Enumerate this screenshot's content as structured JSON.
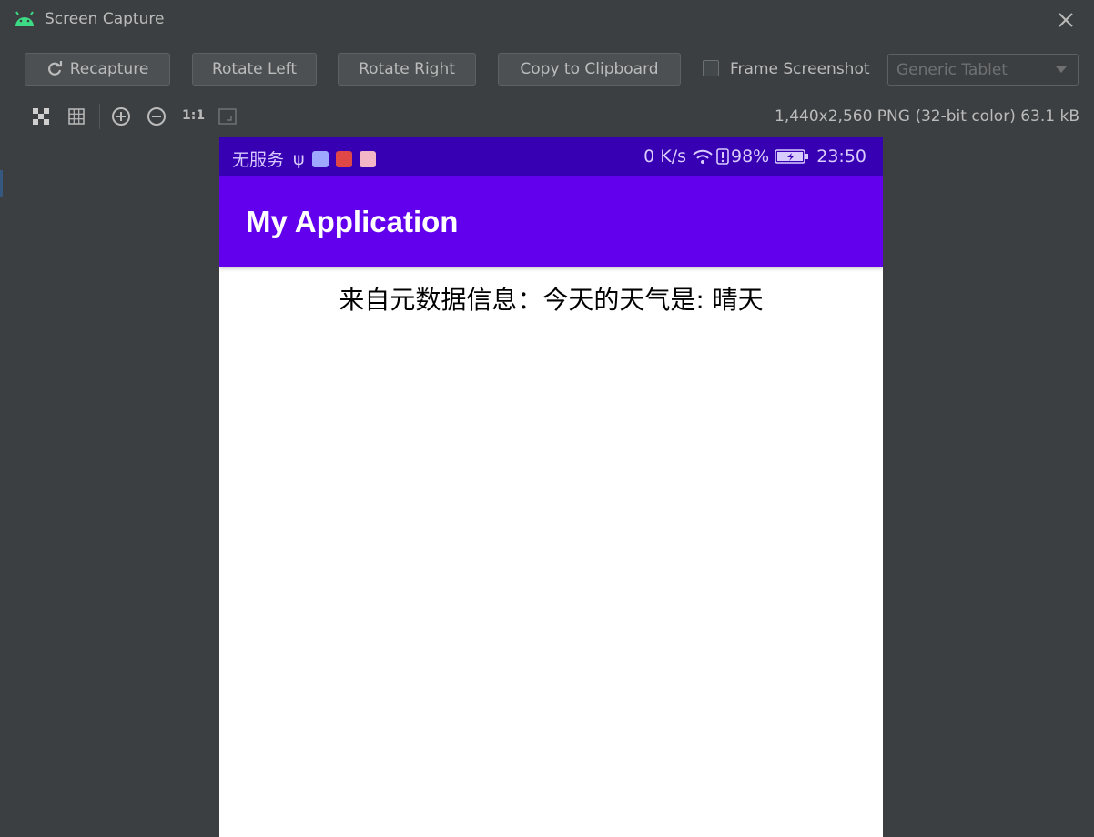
{
  "window": {
    "title": "Screen Capture",
    "icons": {
      "app": "android-icon",
      "close": "close-icon"
    }
  },
  "toolbar": {
    "recapture_label": "Recapture",
    "rotate_left_label": "Rotate Left",
    "rotate_right_label": "Rotate Right",
    "copy_label": "Copy to Clipboard",
    "frame_screenshot_label": "Frame Screenshot",
    "frame_screenshot_checked": false,
    "device_select_value": "Generic Tablet"
  },
  "viewer": {
    "tools": [
      "checkerboard-icon",
      "grid-icon",
      "zoom-in-icon",
      "zoom-out-icon",
      "actual-size-icon",
      "fit-screen-icon"
    ],
    "actual_size_label": "1:1",
    "image_info": "1,440x2,560 PNG (32-bit color) 63.1 kB"
  },
  "phone": {
    "status_left": "无服务",
    "status_speed": "0 K/s",
    "status_battery": "98%",
    "status_time": "23:50",
    "app_title": "My Application",
    "content_text": "来自元数据信息：今天的天气是:   晴天",
    "colors": {
      "statusbar": "#3700b3",
      "appbar": "#6200ee"
    }
  }
}
